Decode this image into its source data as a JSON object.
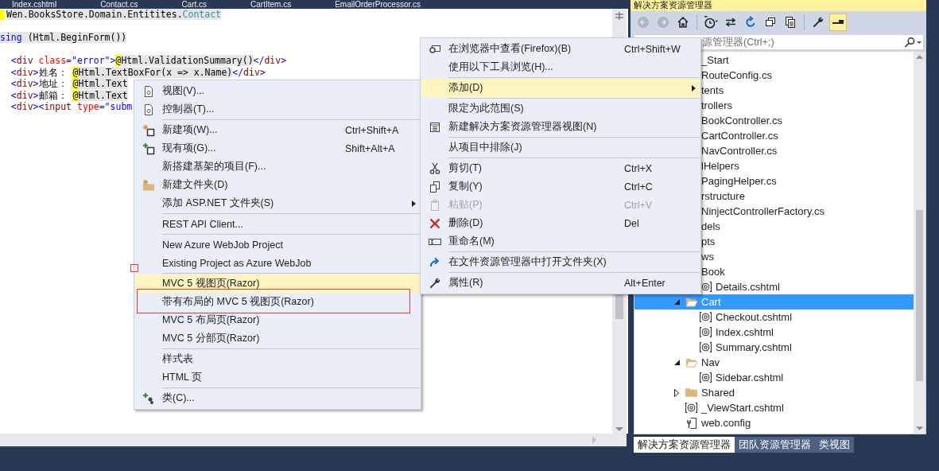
{
  "editor": {
    "tabs": [
      "Index.cshtml",
      "Contact.cs",
      "Cart.cs",
      "CartItem.cs",
      "EmailOrderProcessor.cs"
    ],
    "code_lines": [
      {
        "marker": true,
        "tokens": [
          {
            "kind": "code",
            "text": "Wen.BooksStore.Domain.Entitites."
          },
          {
            "kind": "type",
            "text": "Contact"
          }
        ]
      },
      {
        "blank_before": true,
        "tokens": [
          {
            "kind": "keyword",
            "text": "sing"
          },
          {
            "kind": "code",
            "text": " (Html.BeginForm())"
          }
        ]
      },
      {
        "blank_before": true,
        "tokens": [
          {
            "kind": "punct",
            "text": "  <"
          },
          {
            "kind": "tag",
            "text": "div"
          },
          {
            "kind": "attr",
            "text": " class"
          },
          {
            "kind": "punct",
            "text": "="
          },
          {
            "kind": "string",
            "text": "\"error\""
          },
          {
            "kind": "punct",
            "text": ">"
          },
          {
            "kind": "at",
            "text": "@"
          },
          {
            "kind": "code",
            "text": "Html.ValidationSummary()"
          },
          {
            "kind": "punct",
            "text": "</"
          },
          {
            "kind": "tag",
            "text": "div"
          },
          {
            "kind": "punct",
            "text": ">"
          }
        ]
      },
      {
        "tokens": [
          {
            "kind": "punct",
            "text": "  <"
          },
          {
            "kind": "tag",
            "text": "div"
          },
          {
            "kind": "punct",
            "text": ">"
          },
          {
            "kind": "plain",
            "text": "姓名： "
          },
          {
            "kind": "at",
            "text": "@"
          },
          {
            "kind": "code",
            "text": "Html.TextBoxFor(x => x.Name)"
          },
          {
            "kind": "punct",
            "text": "</"
          },
          {
            "kind": "tag",
            "text": "div"
          },
          {
            "kind": "punct",
            "text": ">"
          }
        ]
      },
      {
        "tokens": [
          {
            "kind": "punct",
            "text": "  <"
          },
          {
            "kind": "tag",
            "text": "div"
          },
          {
            "kind": "punct",
            "text": ">"
          },
          {
            "kind": "plain",
            "text": "地址： "
          },
          {
            "kind": "at",
            "text": "@"
          },
          {
            "kind": "code",
            "text": "Html.Text"
          }
        ]
      },
      {
        "tokens": [
          {
            "kind": "punct",
            "text": "  <"
          },
          {
            "kind": "tag",
            "text": "div"
          },
          {
            "kind": "punct",
            "text": ">"
          },
          {
            "kind": "plain",
            "text": "邮箱： "
          },
          {
            "kind": "at",
            "text": "@"
          },
          {
            "kind": "code",
            "text": "Html.Text"
          }
        ]
      },
      {
        "tokens": [
          {
            "kind": "punct",
            "text": "  <"
          },
          {
            "kind": "tag",
            "text": "div"
          },
          {
            "kind": "punct",
            "text": "><"
          },
          {
            "kind": "tag",
            "text": "input"
          },
          {
            "kind": "attr",
            "text": " type"
          },
          {
            "kind": "punct",
            "text": "="
          },
          {
            "kind": "string",
            "text": "\"subm"
          }
        ]
      }
    ]
  },
  "explorer": {
    "title": "解决方案资源管理器",
    "toolbar": [
      {
        "kind": "button",
        "disabled": true,
        "selected": false
      },
      {
        "kind": "button",
        "disabled": true,
        "selected": false
      },
      {
        "kind": "button",
        "disabled": false,
        "selected": false
      },
      {
        "kind": "separator"
      },
      {
        "kind": "button",
        "disabled": false,
        "selected": false
      },
      {
        "kind": "button",
        "disabled": false,
        "selected": false
      },
      {
        "kind": "button",
        "disabled": false,
        "selected": false
      },
      {
        "kind": "button",
        "disabled": false,
        "selected": false
      },
      {
        "kind": "button",
        "disabled": false,
        "selected": false
      },
      {
        "kind": "separator"
      },
      {
        "kind": "button",
        "disabled": false,
        "selected": false
      },
      {
        "kind": "button",
        "disabled": false,
        "selected": true
      }
    ],
    "search": {
      "placeholder": "源管理器(Ctrl+;)"
    },
    "tree": [
      {
        "label": "_Start",
        "selected": false,
        "children": [
          {
            "label": "RouteConfig.cs",
            "selected": false
          }
        ]
      },
      {
        "label": "tents",
        "selected": false
      },
      {
        "label": "trollers",
        "selected": false,
        "children": [
          {
            "label": "BookController.cs",
            "selected": false
          },
          {
            "label": "CartController.cs",
            "selected": false
          },
          {
            "label": "NavController.cs",
            "selected": false
          }
        ]
      },
      {
        "label": "lHelpers",
        "selected": false,
        "children": [
          {
            "label": "PagingHelper.cs",
            "selected": false
          }
        ]
      },
      {
        "label": "rstructure",
        "selected": false,
        "children": [
          {
            "label": "NinjectControllerFactory.cs",
            "selected": false
          }
        ]
      },
      {
        "label": "dels",
        "selected": false
      },
      {
        "label": "pts",
        "selected": false
      },
      {
        "label": "ws",
        "selected": false,
        "children": [
          {
            "label": "Book",
            "selected": false,
            "children": [
              {
                "kind": "razor",
                "label": "Details.cshtml",
                "selected": false
              }
            ]
          },
          {
            "kind": "folder",
            "label": "Cart",
            "expanded": true,
            "selected": true,
            "children": [
              {
                "kind": "razor",
                "label": "Checkout.cshtml",
                "selected": false
              },
              {
                "kind": "razor",
                "label": "Index.cshtml",
                "selected": false
              },
              {
                "kind": "razor",
                "label": "Summary.cshtml",
                "selected": false
              }
            ]
          },
          {
            "kind": "folder",
            "label": "Nav",
            "expanded": true,
            "selected": false,
            "children": [
              {
                "kind": "razor",
                "label": "Sidebar.cshtml",
                "selected": false
              }
            ]
          },
          {
            "kind": "folder",
            "label": "Shared",
            "expanded": false,
            "selected": false
          },
          {
            "kind": "razor",
            "label": "_ViewStart.cshtml",
            "selected": false
          },
          {
            "kind": "config",
            "label": "web.config",
            "selected": false
          }
        ]
      }
    ],
    "tabs": [
      {
        "label": "解决方案资源管理器",
        "selected": true
      },
      {
        "label": "团队资源管理器",
        "selected": false
      },
      {
        "label": "类视图",
        "selected": false
      }
    ]
  },
  "context_menu": {
    "items": [
      {
        "kind": "browser",
        "label": "在浏览器中查看(Firefox)(B)",
        "shortcut": "Ctrl+Shift+W",
        "submenu": false,
        "selected": false,
        "disabled": false
      },
      {
        "kind": "plain",
        "label": "使用以下工具浏览(H)...",
        "submenu": false,
        "selected": false,
        "disabled": false
      },
      {
        "kind": "separator"
      },
      {
        "kind": "plain",
        "label": "添加(D)",
        "submenu": true,
        "selected": true,
        "disabled": false
      },
      {
        "kind": "separator"
      },
      {
        "kind": "plain",
        "label": "限定为此范围(S)",
        "submenu": false,
        "selected": false,
        "disabled": false
      },
      {
        "kind": "viewwindow",
        "label": "新建解决方案资源管理器视图(N)",
        "submenu": false,
        "selected": false,
        "disabled": false
      },
      {
        "kind": "separator"
      },
      {
        "kind": "plain",
        "label": "从项目中排除(J)",
        "submenu": false,
        "selected": false,
        "disabled": false
      },
      {
        "kind": "separator"
      },
      {
        "kind": "cut",
        "label": "剪切(T)",
        "shortcut": "Ctrl+X",
        "submenu": false,
        "selected": false,
        "disabled": false
      },
      {
        "kind": "copy",
        "label": "复制(Y)",
        "shortcut": "Ctrl+C",
        "submenu": false,
        "selected": false,
        "disabled": false
      },
      {
        "kind": "paste",
        "label": "粘贴(P)",
        "shortcut": "Ctrl+V",
        "submenu": false,
        "selected": false,
        "disabled": true
      },
      {
        "kind": "delete",
        "label": "删除(D)",
        "shortcut": "Del",
        "submenu": false,
        "selected": false,
        "disabled": false
      },
      {
        "kind": "rename",
        "label": "重命名(M)",
        "submenu": false,
        "selected": false,
        "disabled": false
      },
      {
        "kind": "separator"
      },
      {
        "kind": "openfolder",
        "label": "在文件资源管理器中打开文件夹(X)",
        "submenu": false,
        "selected": false,
        "disabled": false
      },
      {
        "kind": "separator"
      },
      {
        "kind": "properties",
        "label": "属性(R)",
        "shortcut": "Alt+Enter",
        "submenu": false,
        "selected": false,
        "disabled": false
      }
    ]
  },
  "add_submenu": {
    "items": [
      {
        "kind": "page",
        "label": "视图(V)...",
        "submenu": false,
        "selected": false,
        "disabled": false,
        "annotated": false
      },
      {
        "kind": "page",
        "label": "控制器(T)...",
        "submenu": false,
        "selected": false,
        "disabled": false,
        "annotated": false
      },
      {
        "kind": "separator"
      },
      {
        "kind": "newitem",
        "label": "新建项(W)...",
        "shortcut": "Ctrl+Shift+A",
        "submenu": false,
        "selected": false,
        "disabled": false,
        "annotated": false
      },
      {
        "kind": "existing",
        "label": "现有项(G)...",
        "shortcut": "Shift+Alt+A",
        "submenu": false,
        "selected": false,
        "disabled": false,
        "annotated": false
      },
      {
        "kind": "plain",
        "label": "新搭建基架的项目(F)...",
        "submenu": false,
        "selected": false,
        "disabled": false,
        "annotated": false
      },
      {
        "kind": "newfolder",
        "label": "新建文件夹(D)",
        "submenu": false,
        "selected": false,
        "disabled": false,
        "annotated": false
      },
      {
        "kind": "plain",
        "label": "添加 ASP.NET 文件夹(S)",
        "submenu": true,
        "selected": false,
        "disabled": false,
        "annotated": false
      },
      {
        "kind": "separator"
      },
      {
        "kind": "plain",
        "label": "REST API Client...",
        "submenu": false,
        "selected": false,
        "disabled": false,
        "annotated": false
      },
      {
        "kind": "separator"
      },
      {
        "kind": "plain",
        "label": "New Azure WebJob Project",
        "submenu": false,
        "selected": false,
        "disabled": false,
        "annotated": false
      },
      {
        "kind": "plain",
        "label": "Existing Project as Azure WebJob",
        "submenu": false,
        "selected": false,
        "disabled": false,
        "annotated": false
      },
      {
        "kind": "separator"
      },
      {
        "kind": "plain",
        "label": "MVC 5 视图页(Razor)",
        "submenu": false,
        "selected": true,
        "disabled": false,
        "annotated": false
      },
      {
        "kind": "plain",
        "label": "带有布局的 MVC 5 视图页(Razor)",
        "submenu": false,
        "selected": false,
        "disabled": false,
        "annotated": true
      },
      {
        "kind": "plain",
        "label": "MVC 5 布局页(Razor)",
        "submenu": false,
        "selected": false,
        "disabled": false,
        "annotated": false
      },
      {
        "kind": "plain",
        "label": "MVC 5 分部页(Razor)",
        "submenu": false,
        "selected": false,
        "disabled": false,
        "annotated": false
      },
      {
        "kind": "separator"
      },
      {
        "kind": "plain",
        "label": "样式表",
        "submenu": false,
        "selected": false,
        "disabled": false,
        "annotated": false
      },
      {
        "kind": "plain",
        "label": "HTML 页",
        "submenu": false,
        "selected": false,
        "disabled": false,
        "annotated": false
      },
      {
        "kind": "separator"
      },
      {
        "kind": "classitem",
        "label": "类(C)...",
        "submenu": false,
        "selected": false,
        "disabled": false,
        "annotated": false
      }
    ]
  }
}
